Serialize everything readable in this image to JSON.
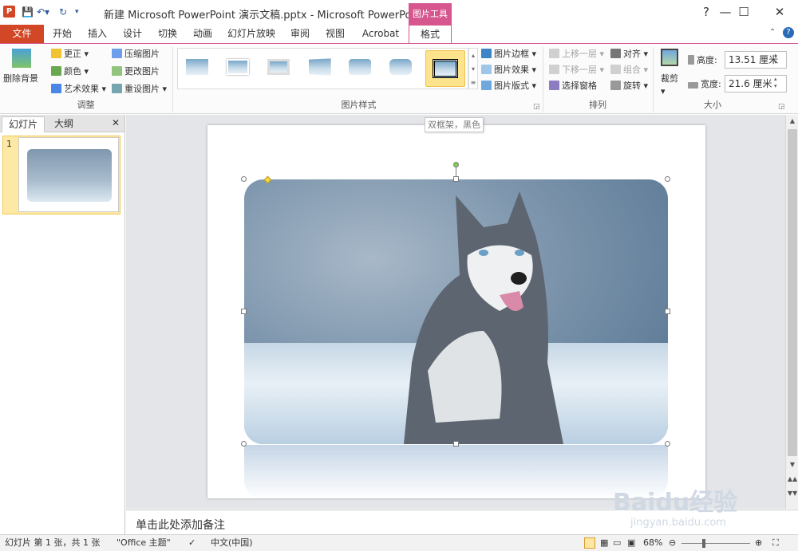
{
  "title_bar": {
    "app_icon": "P",
    "title": "新建 Microsoft PowerPoint 演示文稿.pptx - Microsoft PowerPoint",
    "context_group": "图片工具"
  },
  "tabs": [
    "文件",
    "开始",
    "插入",
    "设计",
    "切换",
    "动画",
    "幻灯片放映",
    "审阅",
    "视图",
    "Acrobat",
    "格式"
  ],
  "ribbon": {
    "adjust": {
      "remove_bg": "删除背景",
      "corrections": "更正",
      "color": "颜色",
      "artistic": "艺术效果",
      "compress": "压缩图片",
      "change": "更改图片",
      "reset": "重设图片",
      "label": "调整"
    },
    "styles": {
      "label": "图片样式",
      "border": "图片边框",
      "effects": "图片效果",
      "layout": "图片版式"
    },
    "arrange": {
      "label": "排列",
      "bring_forward": "上移一层",
      "send_backward": "下移一层",
      "selection_pane": "选择窗格",
      "align": "对齐",
      "group": "组合",
      "rotate": "旋转"
    },
    "size": {
      "label": "大小",
      "crop": "裁剪",
      "height_label": "高度:",
      "height": "13.51 厘米",
      "width_label": "宽度:",
      "width": "21.6 厘米"
    }
  },
  "tooltip": "双框架，黑色",
  "left_panel": {
    "tab_slides": "幻灯片",
    "tab_outline": "大纲",
    "close": "✕",
    "slide_number": "1"
  },
  "notes_placeholder": "单击此处添加备注",
  "status": {
    "slide_info": "幻灯片 第 1 张，共 1 张",
    "theme": "\"Office 主题\"",
    "language": "中文(中国)",
    "zoom": "68%"
  },
  "watermark": {
    "brand": "Baidu经验",
    "url": "jingyan.baidu.com"
  },
  "colors": {
    "file_tab": "#d24726",
    "context_tab": "#d6568e"
  }
}
